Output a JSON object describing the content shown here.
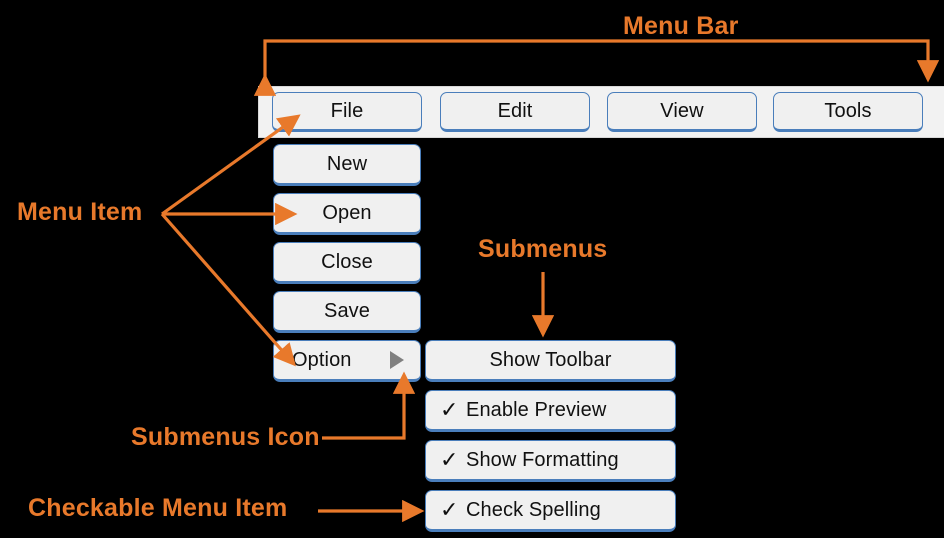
{
  "diagram": {
    "title": "Menu anatomy diagram",
    "background_color": "#000000",
    "accent_color": "#E8792B",
    "button_border_color": "#4a7ebb",
    "button_fill_color": "#f0f0f0",
    "menubar_fill_color": "#f2f2f2",
    "submenu_icon_color": "#808080"
  },
  "menubar": {
    "items": [
      {
        "label": "File"
      },
      {
        "label": "Edit"
      },
      {
        "label": "View"
      },
      {
        "label": "Tools"
      }
    ]
  },
  "file_menu": {
    "items": [
      {
        "label": "New",
        "has_submenu": false,
        "checked": false
      },
      {
        "label": "Open",
        "has_submenu": false,
        "checked": false
      },
      {
        "label": "Close",
        "has_submenu": false,
        "checked": false
      },
      {
        "label": "Save",
        "has_submenu": false,
        "checked": false
      },
      {
        "label": "Option",
        "has_submenu": true,
        "checked": false
      }
    ]
  },
  "option_submenu": {
    "items": [
      {
        "label": "Show Toolbar",
        "checked": false,
        "check_glyph": ""
      },
      {
        "label": "Enable Preview",
        "checked": true,
        "check_glyph": "✓"
      },
      {
        "label": "Show Formatting",
        "checked": true,
        "check_glyph": "✓"
      },
      {
        "label": "Check Spelling",
        "checked": true,
        "check_glyph": "✓"
      }
    ]
  },
  "annotations": [
    {
      "id": "menu-bar",
      "label": "Menu Bar"
    },
    {
      "id": "menu-item",
      "label": "Menu Item"
    },
    {
      "id": "submenus",
      "label": "Submenus"
    },
    {
      "id": "submenus-icon",
      "label": "Submenus Icon"
    },
    {
      "id": "checkable-menu-item",
      "label": "Checkable Menu Item"
    }
  ]
}
